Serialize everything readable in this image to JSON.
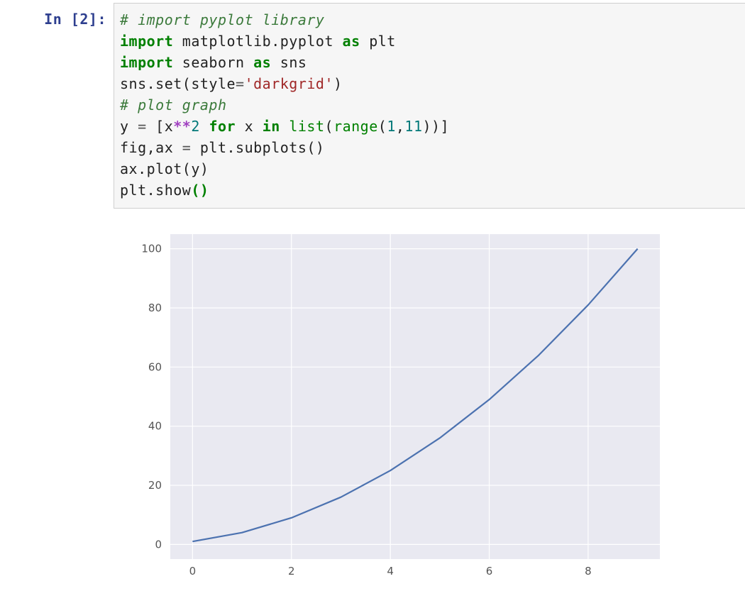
{
  "cell": {
    "prompt_label": "In",
    "exec_count": "2",
    "code_tokens": [
      [
        {
          "t": "# import pyplot library",
          "c": "comment"
        }
      ],
      [
        {
          "t": "import",
          "c": "keyword"
        },
        {
          "t": " ",
          "c": "name"
        },
        {
          "t": "matplotlib.pyplot",
          "c": "name"
        },
        {
          "t": " ",
          "c": "name"
        },
        {
          "t": "as",
          "c": "keyword"
        },
        {
          "t": " ",
          "c": "name"
        },
        {
          "t": "plt",
          "c": "name"
        }
      ],
      [
        {
          "t": "import",
          "c": "keyword"
        },
        {
          "t": " ",
          "c": "name"
        },
        {
          "t": "seaborn",
          "c": "name"
        },
        {
          "t": " ",
          "c": "name"
        },
        {
          "t": "as",
          "c": "keyword"
        },
        {
          "t": " ",
          "c": "name"
        },
        {
          "t": "sns",
          "c": "name"
        }
      ],
      [
        {
          "t": "sns.set(style",
          "c": "name"
        },
        {
          "t": "=",
          "c": "op"
        },
        {
          "t": "'darkgrid'",
          "c": "string"
        },
        {
          "t": ")",
          "c": "name"
        }
      ],
      [
        {
          "t": "# plot graph",
          "c": "comment"
        }
      ],
      [
        {
          "t": "y ",
          "c": "name"
        },
        {
          "t": "=",
          "c": "op"
        },
        {
          "t": " [x",
          "c": "name"
        },
        {
          "t": "**",
          "c": "oppow"
        },
        {
          "t": "2",
          "c": "number"
        },
        {
          "t": " ",
          "c": "name"
        },
        {
          "t": "for",
          "c": "keyword"
        },
        {
          "t": " x ",
          "c": "name"
        },
        {
          "t": "in",
          "c": "keyword"
        },
        {
          "t": " ",
          "c": "name"
        },
        {
          "t": "list",
          "c": "builtin"
        },
        {
          "t": "(",
          "c": "name"
        },
        {
          "t": "range",
          "c": "builtin"
        },
        {
          "t": "(",
          "c": "name"
        },
        {
          "t": "1",
          "c": "number"
        },
        {
          "t": ",",
          "c": "name"
        },
        {
          "t": "11",
          "c": "number"
        },
        {
          "t": "))]",
          "c": "name"
        }
      ],
      [
        {
          "t": "fig,ax ",
          "c": "name"
        },
        {
          "t": "=",
          "c": "op"
        },
        {
          "t": " plt.subplots()",
          "c": "name"
        }
      ],
      [
        {
          "t": "ax.plot(y)",
          "c": "name"
        }
      ],
      [
        {
          "t": "plt.show",
          "c": "name"
        },
        {
          "t": "(",
          "c": "parenok"
        },
        {
          "t": ")",
          "c": "parenok"
        }
      ]
    ]
  },
  "chart_data": {
    "type": "line",
    "x": [
      0,
      1,
      2,
      3,
      4,
      5,
      6,
      7,
      8,
      9
    ],
    "values": [
      1,
      4,
      9,
      16,
      25,
      36,
      49,
      64,
      81,
      100
    ],
    "x_ticks": [
      0,
      2,
      4,
      6,
      8
    ],
    "y_ticks": [
      0,
      20,
      40,
      60,
      80,
      100
    ],
    "xlim": [
      -0.45,
      9.45
    ],
    "ylim": [
      -4.95,
      104.95
    ],
    "title": "",
    "xlabel": "",
    "ylabel": "",
    "grid": true,
    "style": "darkgrid",
    "line_color": "#4c72b0",
    "bg_color": "#e9e9f1"
  }
}
